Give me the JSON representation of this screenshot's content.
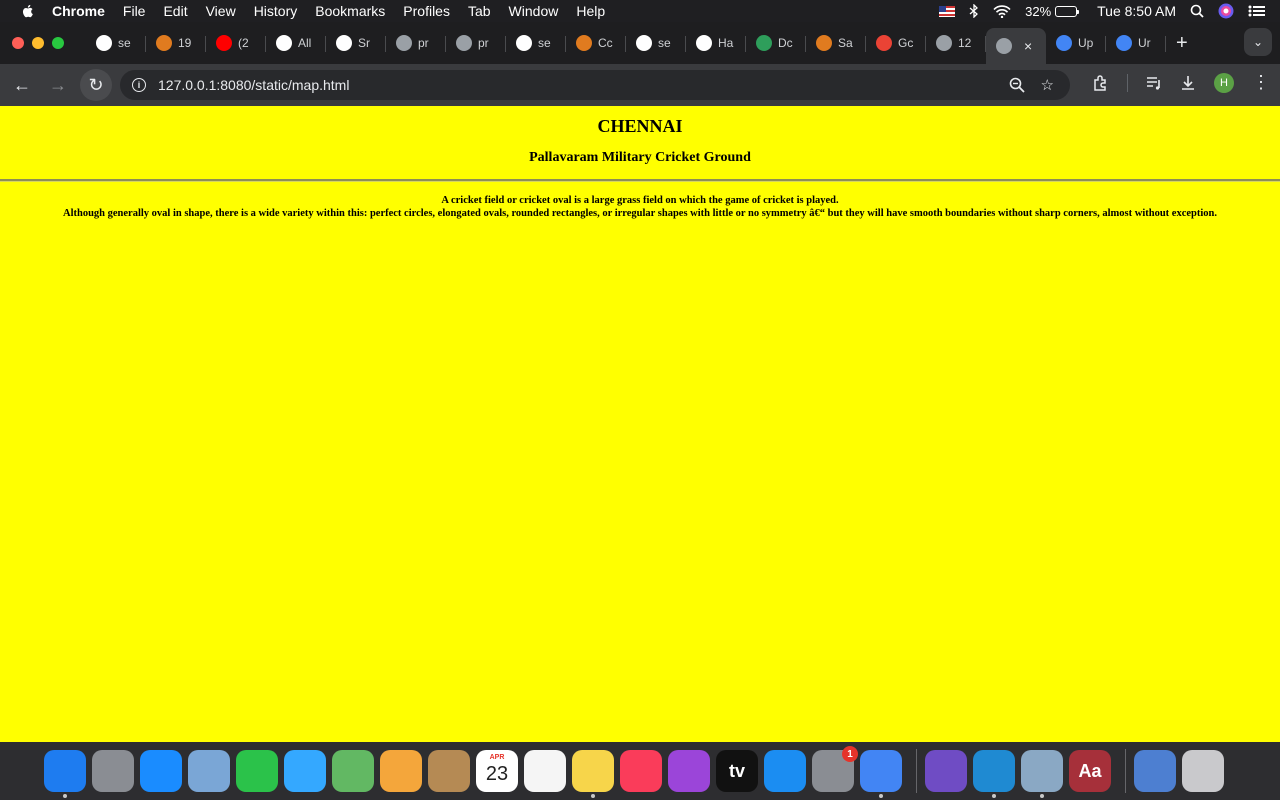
{
  "menubar": {
    "app_name": "Chrome",
    "menus": [
      "File",
      "Edit",
      "View",
      "History",
      "Bookmarks",
      "Profiles",
      "Tab",
      "Window",
      "Help"
    ],
    "battery_percent": "32%",
    "battery_level": 0.32,
    "clock": "Tue 8:50 AM"
  },
  "tabs": [
    {
      "title": "se",
      "icon": "github-icon",
      "color": "#ffffff"
    },
    {
      "title": "19",
      "icon": "medium-icon",
      "color": "#e07b1f"
    },
    {
      "title": "(2",
      "icon": "youtube-icon",
      "color": "#ff0000"
    },
    {
      "title": "All",
      "icon": "github-icon",
      "color": "#ffffff"
    },
    {
      "title": "Sr",
      "icon": "github-icon",
      "color": "#ffffff"
    },
    {
      "title": "pr",
      "icon": "globe-icon",
      "color": "#9aa0a6"
    },
    {
      "title": "pr",
      "icon": "globe-icon",
      "color": "#9aa0a6"
    },
    {
      "title": "se",
      "icon": "github-icon",
      "color": "#ffffff"
    },
    {
      "title": "Cc",
      "icon": "medium-icon",
      "color": "#e07b1f"
    },
    {
      "title": "se",
      "icon": "github-icon",
      "color": "#ffffff"
    },
    {
      "title": "Ha",
      "icon": "github-icon",
      "color": "#ffffff"
    },
    {
      "title": "Dc",
      "icon": "w-icon",
      "color": "#2e9e5b"
    },
    {
      "title": "Sa",
      "icon": "medium-icon",
      "color": "#e07b1f"
    },
    {
      "title": "Gc",
      "icon": "maps-pin-icon",
      "color": "#ea4335"
    },
    {
      "title": "12",
      "icon": "globe-icon",
      "color": "#9aa0a6"
    },
    {
      "title": "",
      "icon": "globe-icon",
      "color": "#9aa0a6",
      "active": true
    },
    {
      "title": "Up",
      "icon": "c-icon",
      "color": "#4285f4"
    },
    {
      "title": "Ur",
      "icon": "c-icon",
      "color": "#4285f4"
    }
  ],
  "toolbar": {
    "url": "127.0.0.1:8080/static/map.html",
    "profile_initial": "H"
  },
  "page": {
    "title": "CHENNAI",
    "subtitle": "Pallavaram Military Cricket Ground",
    "line1": "A cricket field or cricket oval is a large grass field on which the game of cricket is played.",
    "line2": "Although generally oval in shape, there is a wide variety within this: perfect circles, elongated ovals, rounded rectangles, or irregular shapes with little or no symmetry â€“ but they will have smooth boundaries without sharp corners, almost without exception.",
    "background": "#ffff00"
  },
  "dock": {
    "apps": [
      {
        "name": "finder-icon",
        "color": "#1e7cf0",
        "running": true
      },
      {
        "name": "launchpad-icon",
        "color": "#8a8d93"
      },
      {
        "name": "safari-icon",
        "color": "#1a8cff"
      },
      {
        "name": "mail-icon",
        "color": "#7aa6d6"
      },
      {
        "name": "facetime-icon",
        "color": "#2bc24a"
      },
      {
        "name": "messages-icon",
        "color": "#34a8ff"
      },
      {
        "name": "maps-icon",
        "color": "#62b863"
      },
      {
        "name": "photos-icon",
        "color": "#f4a63b"
      },
      {
        "name": "contacts-icon",
        "color": "#b58a54"
      },
      {
        "name": "calendar-icon",
        "color": "#ffffff",
        "month": "APR",
        "day": "23"
      },
      {
        "name": "reminders-icon",
        "color": "#f5f5f5"
      },
      {
        "name": "notes-icon",
        "color": "#f7d54a",
        "running": true
      },
      {
        "name": "music-icon",
        "color": "#fa3c5a"
      },
      {
        "name": "podcasts-icon",
        "color": "#9b45d9"
      },
      {
        "name": "appletv-icon",
        "color": "#111111",
        "label": "tv"
      },
      {
        "name": "appstore-icon",
        "color": "#1b8df2"
      },
      {
        "name": "system-preferences-icon",
        "color": "#8a8d93",
        "badge": "1"
      },
      {
        "name": "chrome-icon",
        "color": "#4285f4",
        "running": true
      }
    ],
    "apps2": [
      {
        "name": "bittorrent-icon",
        "color": "#6f4cc4"
      },
      {
        "name": "vscode-icon",
        "color": "#1f8ad2",
        "running": true
      },
      {
        "name": "preview-icon",
        "color": "#8aa8c4",
        "running": true
      },
      {
        "name": "dictionary-icon",
        "color": "#a6303a",
        "label": "Aa"
      }
    ],
    "apps3": [
      {
        "name": "downloads-folder-icon",
        "color": "#4d7fd1"
      },
      {
        "name": "trash-icon",
        "color": "#c9c9cc"
      }
    ]
  }
}
